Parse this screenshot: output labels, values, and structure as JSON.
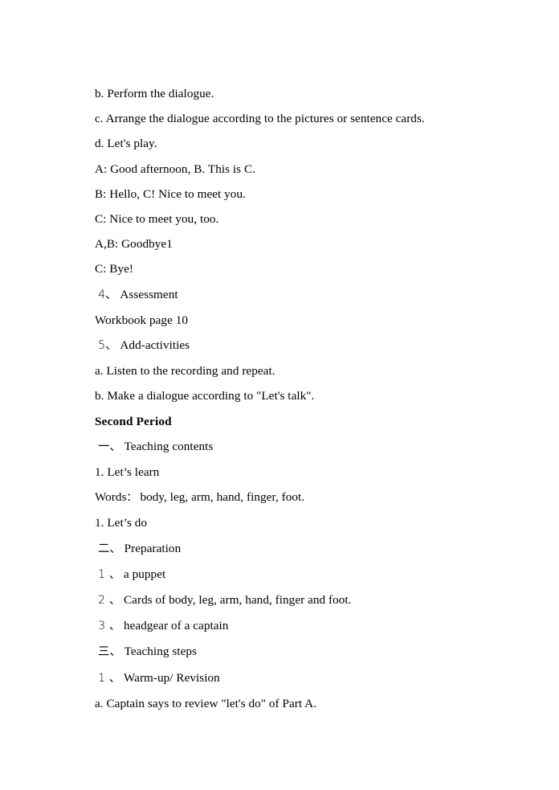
{
  "document": {
    "type": "lesson-plan",
    "page_background": "#ffffff",
    "text_color": "#000000",
    "body": [
      {
        "id": "l1",
        "text": "b. Perform the dialogue.",
        "style": "normal"
      },
      {
        "id": "l2",
        "text": "c. Arrange the dialogue according to the pictures or sentence cards.",
        "style": "normal"
      },
      {
        "id": "l3",
        "text": "d. Let's play.",
        "style": "normal"
      },
      {
        "id": "l4",
        "text": "A: Good afternoon, B. This is C.",
        "style": "normal"
      },
      {
        "id": "l5",
        "text": "B: Hello, C! Nice to meet you.",
        "style": "normal"
      },
      {
        "id": "l6",
        "text": "C: Nice to meet you, too.",
        "style": "normal"
      },
      {
        "id": "l7",
        "text": "A,B: Goodbye1",
        "style": "normal"
      },
      {
        "id": "l8",
        "text": "C: Bye!",
        "style": "normal"
      },
      {
        "id": "l9",
        "marker": "4、",
        "text": "Assessment",
        "style": "enum"
      },
      {
        "id": "l10",
        "text": "Workbook page 10",
        "style": "normal"
      },
      {
        "id": "l11",
        "marker": "5、",
        "text": "Add-activities",
        "style": "enum"
      },
      {
        "id": "l12",
        "text": "a. Listen to the recording and repeat.",
        "style": "normal"
      },
      {
        "id": "l13",
        "text": "b. Make a dialogue according to \"Let's talk\".",
        "style": "normal"
      },
      {
        "id": "l14",
        "text": "Second Period",
        "style": "bold"
      },
      {
        "id": "l15",
        "marker": "一、",
        "text": "Teaching contents",
        "style": "enum"
      },
      {
        "id": "l16",
        "text": "1. Let’s learn",
        "style": "normal"
      },
      {
        "id": "l17",
        "text": "Words：body, leg, arm, hand, finger, foot.",
        "style": "normal"
      },
      {
        "id": "l18",
        "text": "1. Let’s do",
        "style": "normal"
      },
      {
        "id": "l19",
        "marker": "二、",
        "text": "Preparation",
        "style": "enum"
      },
      {
        "id": "l20",
        "marker": "1 、",
        "text": "a puppet",
        "style": "enum"
      },
      {
        "id": "l21",
        "marker": "2 、",
        "text": "Cards of body, leg, arm, hand, finger and foot.",
        "style": "enum"
      },
      {
        "id": "l22",
        "marker": "3 、",
        "text": "headgear of a captain",
        "style": "enum"
      },
      {
        "id": "l23",
        "marker": "三、",
        "text": "Teaching steps",
        "style": "enum"
      },
      {
        "id": "l24",
        "marker": "1 、",
        "text": "Warm-up/ Revision",
        "style": "enum"
      },
      {
        "id": "l25",
        "text": "a. Captain says to review \"let's do\" of Part A.",
        "style": "normal"
      }
    ]
  }
}
